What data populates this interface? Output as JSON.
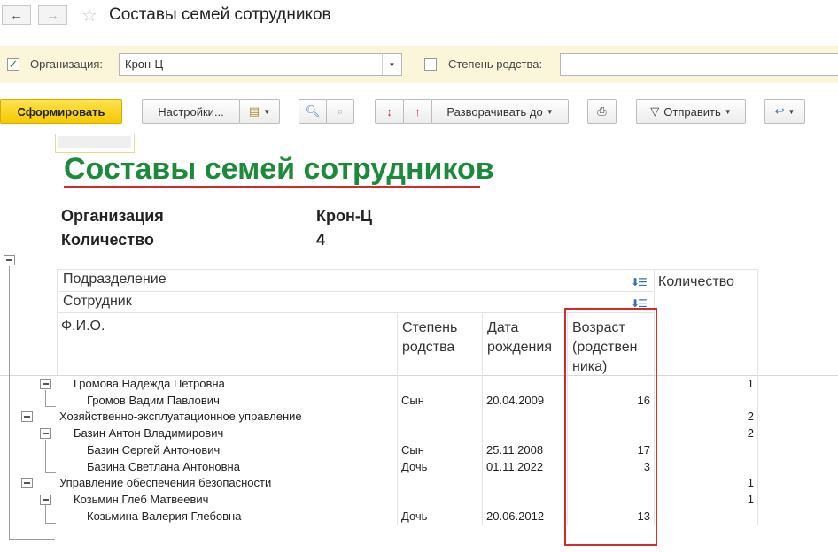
{
  "window": {
    "title": "Составы семей сотрудников",
    "back": "←",
    "forward": "→",
    "star": "☆"
  },
  "filters": {
    "organization": {
      "checked": true,
      "label": "Организация:",
      "value": "Крон-Ц"
    },
    "kinship": {
      "checked": false,
      "label": "Степень родства:",
      "value": ""
    }
  },
  "toolbar": {
    "generate": "Сформировать",
    "settings": "Настройки...",
    "expand_to": "Разворачивать до",
    "send": "Отправить"
  },
  "report": {
    "title": "Составы семей сотрудников",
    "params": [
      {
        "label": "Организация",
        "value": "Крон-Ц"
      },
      {
        "label": "Количество",
        "value": "4"
      }
    ],
    "headers": {
      "department": "Подразделение",
      "employee": "Сотрудник",
      "quantity": "Количество",
      "fio": "Ф.И.О.",
      "kinship_lines": [
        "Степень",
        "родства"
      ],
      "birthdate_lines": [
        "Дата",
        "рождения"
      ],
      "age_lines": [
        "Возраст",
        "(родствен",
        "ника)"
      ]
    },
    "rows": [
      {
        "name": "Громова Надежда Петровна",
        "kinship": "",
        "birthdate": "",
        "age": "",
        "count": "1"
      },
      {
        "name": "Громов Вадим Павлович",
        "kinship": "Сын",
        "birthdate": "20.04.2009",
        "age": "16",
        "count": ""
      },
      {
        "name": "Хозяйственно-эксплуатационное управление",
        "kinship": "",
        "birthdate": "",
        "age": "",
        "count": "2"
      },
      {
        "name": "Базин Антон Владимирович",
        "kinship": "",
        "birthdate": "",
        "age": "",
        "count": "2"
      },
      {
        "name": "Базин Сергей Антонович",
        "kinship": "Сын",
        "birthdate": "25.11.2008",
        "age": "17",
        "count": ""
      },
      {
        "name": "Базина Светлана Антоновна",
        "kinship": "Дочь",
        "birthdate": "01.11.2022",
        "age": "3",
        "count": ""
      },
      {
        "name": "Управление обеспечения безопасности",
        "kinship": "",
        "birthdate": "",
        "age": "",
        "count": "1"
      },
      {
        "name": "Козьмин Глеб Матвеевич",
        "kinship": "",
        "birthdate": "",
        "age": "",
        "count": "1"
      },
      {
        "name": "Козьмина Валерия Глебовна",
        "kinship": "Дочь",
        "birthdate": "20.06.2012",
        "age": "13",
        "count": ""
      }
    ]
  },
  "colors": {
    "title_green": "#1c8a3a",
    "highlight_red": "#d22b2b",
    "filter_bg": "#fbf6d9",
    "primary_yellow": "#f5c800"
  }
}
